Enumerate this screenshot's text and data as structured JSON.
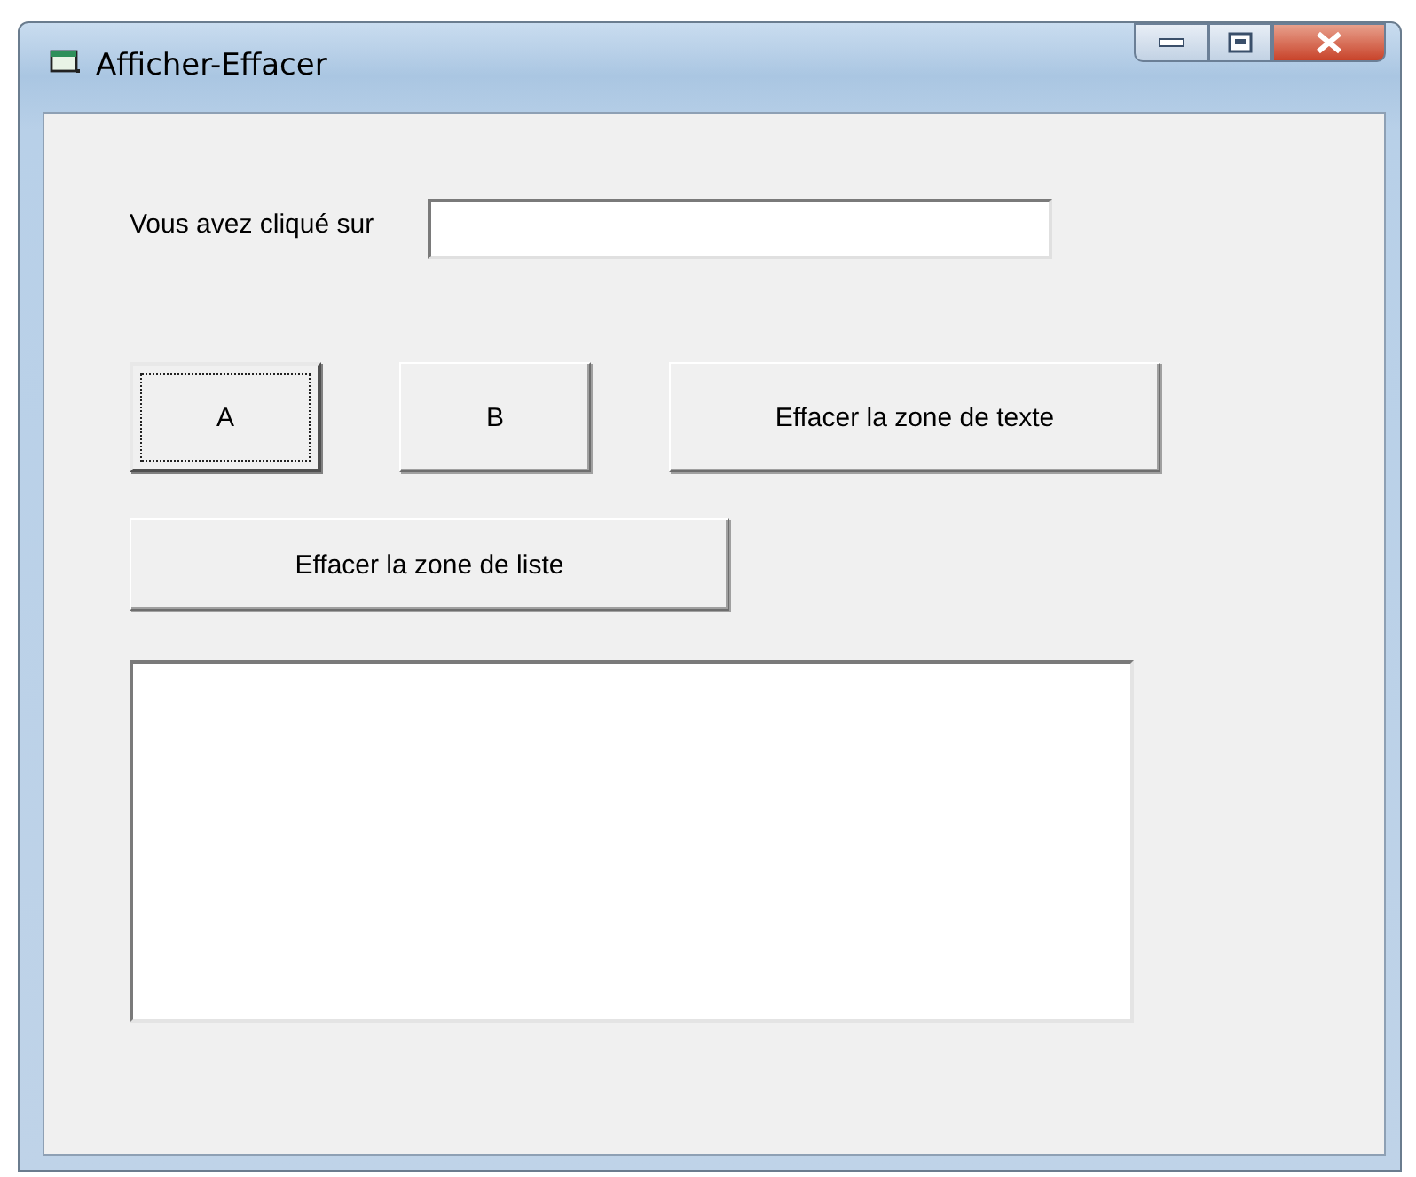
{
  "window": {
    "title": "Afficher-Effacer"
  },
  "label": "Vous avez cliqué sur",
  "buttons": [
    {
      "label": "A",
      "focused": true
    },
    {
      "label": "B",
      "focused": false
    },
    {
      "label": "Effacer la zone de texte",
      "focused": false
    },
    {
      "label": "Effacer la zone de liste",
      "focused": false
    }
  ]
}
